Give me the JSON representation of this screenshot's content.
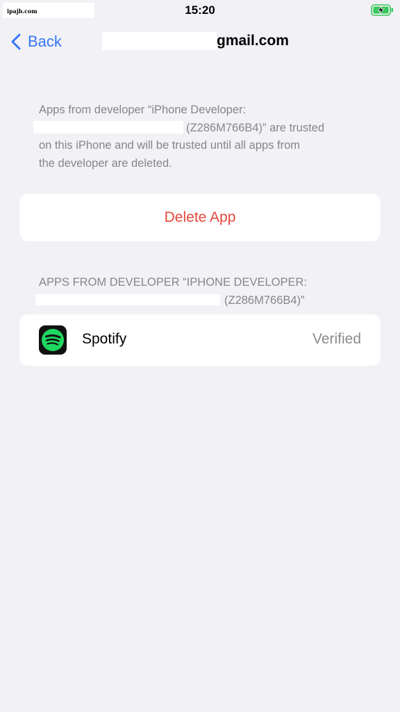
{
  "status_bar": {
    "carrier": "ipajb.com",
    "time": "15:20"
  },
  "nav": {
    "back_label": "Back",
    "title_suffix": "gmail.com"
  },
  "trust_note": {
    "line1": "Apps from developer “iPhone Developer:",
    "line2_suffix": "(Z286M766B4)” are trusted",
    "line3": "on this iPhone and will be trusted until all apps from",
    "line4": "the developer are deleted."
  },
  "delete_button": {
    "label": "Delete App"
  },
  "apps_section": {
    "header_line1": "APPS FROM DEVELOPER “IPHONE DEVELOPER:",
    "header_line2_suffix": "(Z286M766B4)”",
    "apps": [
      {
        "name": "Spotify",
        "status": "Verified",
        "icon": "spotify-icon"
      }
    ]
  },
  "colors": {
    "background": "#f2f1f6",
    "accent": "#3478f6",
    "destructive": "#e5473b",
    "secondary_text": "#85858a",
    "spotify_green": "#1ed760",
    "battery_green": "#34c759"
  }
}
